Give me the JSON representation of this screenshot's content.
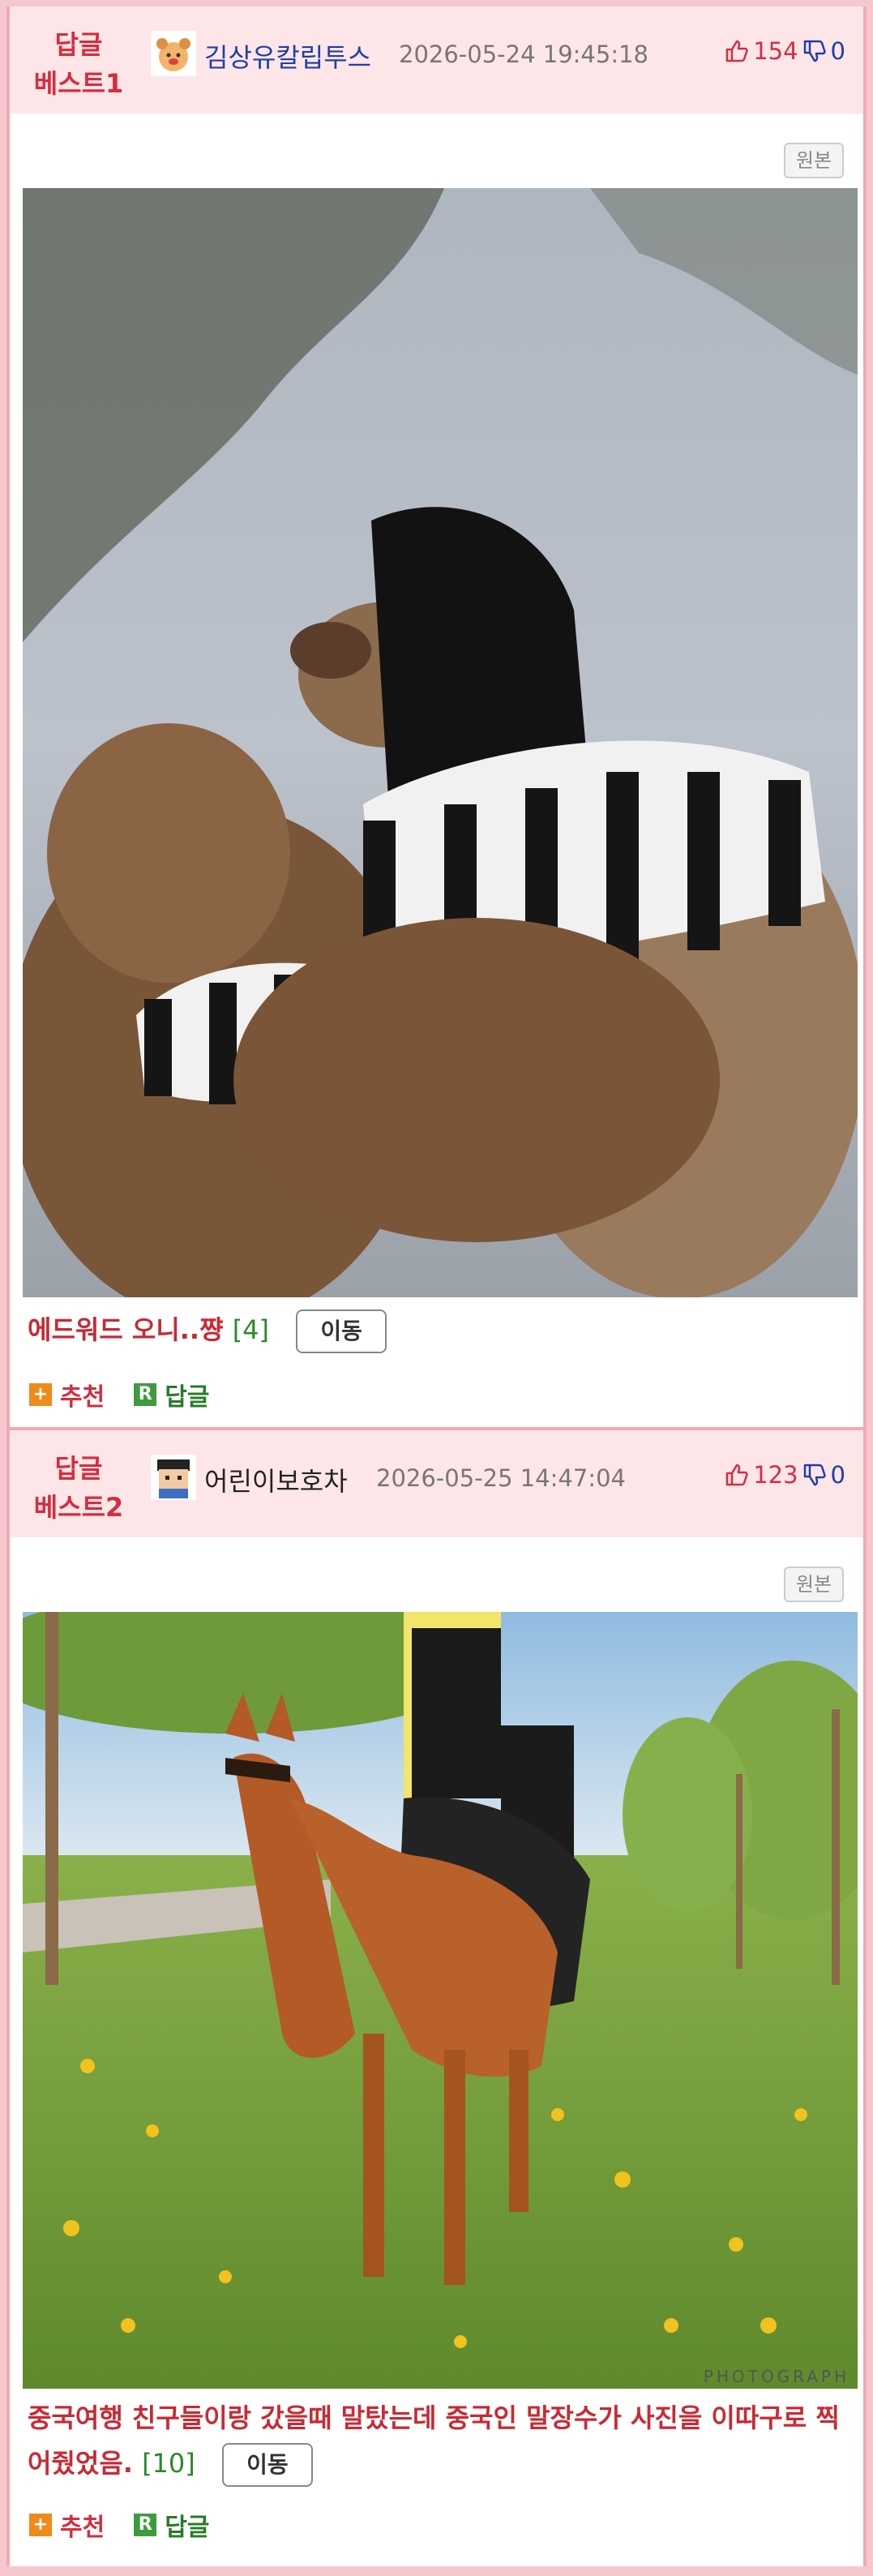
{
  "posts": [
    {
      "label_top": "답글",
      "label_bottom": "베스트1",
      "author": "김상유칼립투스",
      "date": "2026-05-24 19:45:18",
      "upvotes": "154",
      "downvotes": "0",
      "original_label": "원본",
      "title": "에드워드 오니..쨩",
      "comment_count": "[4]",
      "move_label": "이동",
      "recommend_label": "추천",
      "reply_label": "답글",
      "reply_badge": "R",
      "recommend_badge": "+"
    },
    {
      "label_top": "답글",
      "label_bottom": "베스트2",
      "author": "어린이보호차",
      "date": "2026-05-25 14:47:04",
      "upvotes": "123",
      "downvotes": "0",
      "original_label": "원본",
      "title": "중국여행 친구들이랑 갔을때 말탔는데 중국인 말장수가 사진을 이따구로 찍어줬었음.",
      "comment_count": "[10]",
      "move_label": "이동",
      "recommend_label": "추천",
      "reply_label": "답글",
      "reply_badge": "R",
      "recommend_badge": "+",
      "photo_watermark": "PHOTOGRAPH"
    }
  ],
  "colors": {
    "accent_red": "#d62d3f",
    "header_bg": "#fde6e8",
    "frame_border": "#f2aab2",
    "down_blue": "#1f3ea8",
    "count_green": "#2a8a2a"
  },
  "icons": {
    "up": "thumbs-up-icon",
    "down": "thumbs-down-icon",
    "avatar1": "bear-avatar-icon",
    "avatar2": "pixel-boy-avatar-icon"
  }
}
